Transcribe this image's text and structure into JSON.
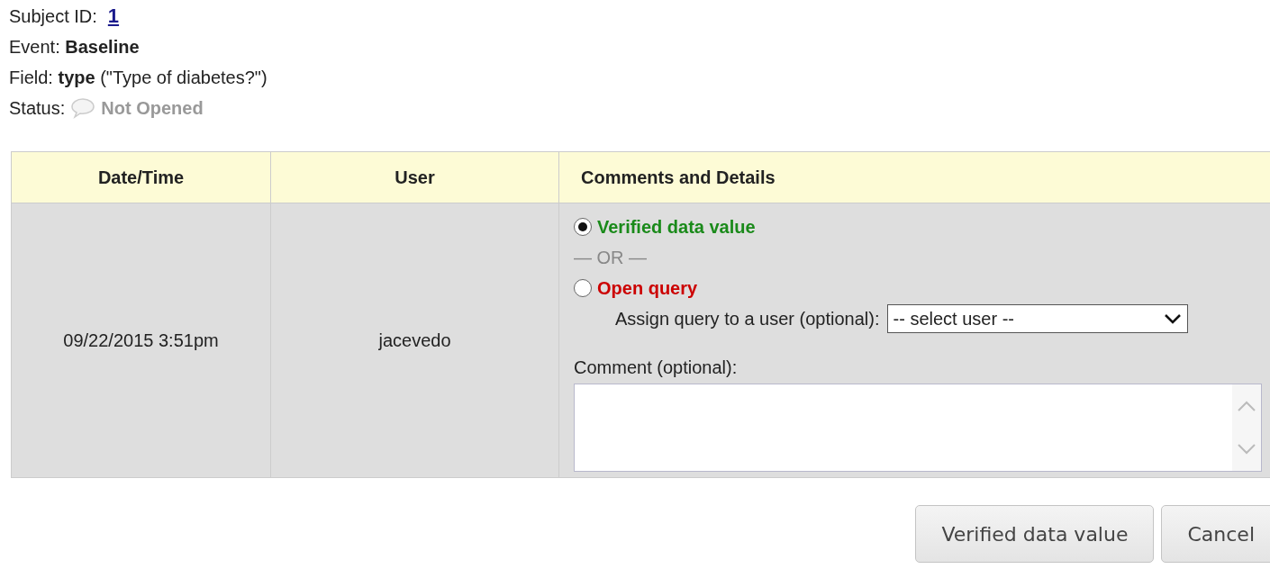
{
  "info": {
    "subject_label": "Subject ID:",
    "subject_id": "1",
    "event": "Event: **Baseline**",
    "field": "Field: **type** (\"Type of diabetes?\")",
    "status_label": "Status:",
    "status": "Not Opened"
  },
  "table": {
    "columns": [
      "Date/Time",
      "User",
      "Comments and Details"
    ],
    "row": {
      "datetime": "09/22/2015 3:51pm",
      "user": "jacevedo",
      "options": [
        {
          "label": "Verified data value",
          "selected": true,
          "color": "#1a8a1a"
        },
        {
          "label": "Open query",
          "selected": false,
          "color": "#cc0000"
        }
      ],
      "separator": "— OR —",
      "assign_label": "Assign query to a user (optional):",
      "assign_value": "-- select user --",
      "comment_label": "Comment (optional):"
    }
  },
  "buttons": [
    "Verified data value",
    "Cancel"
  ]
}
